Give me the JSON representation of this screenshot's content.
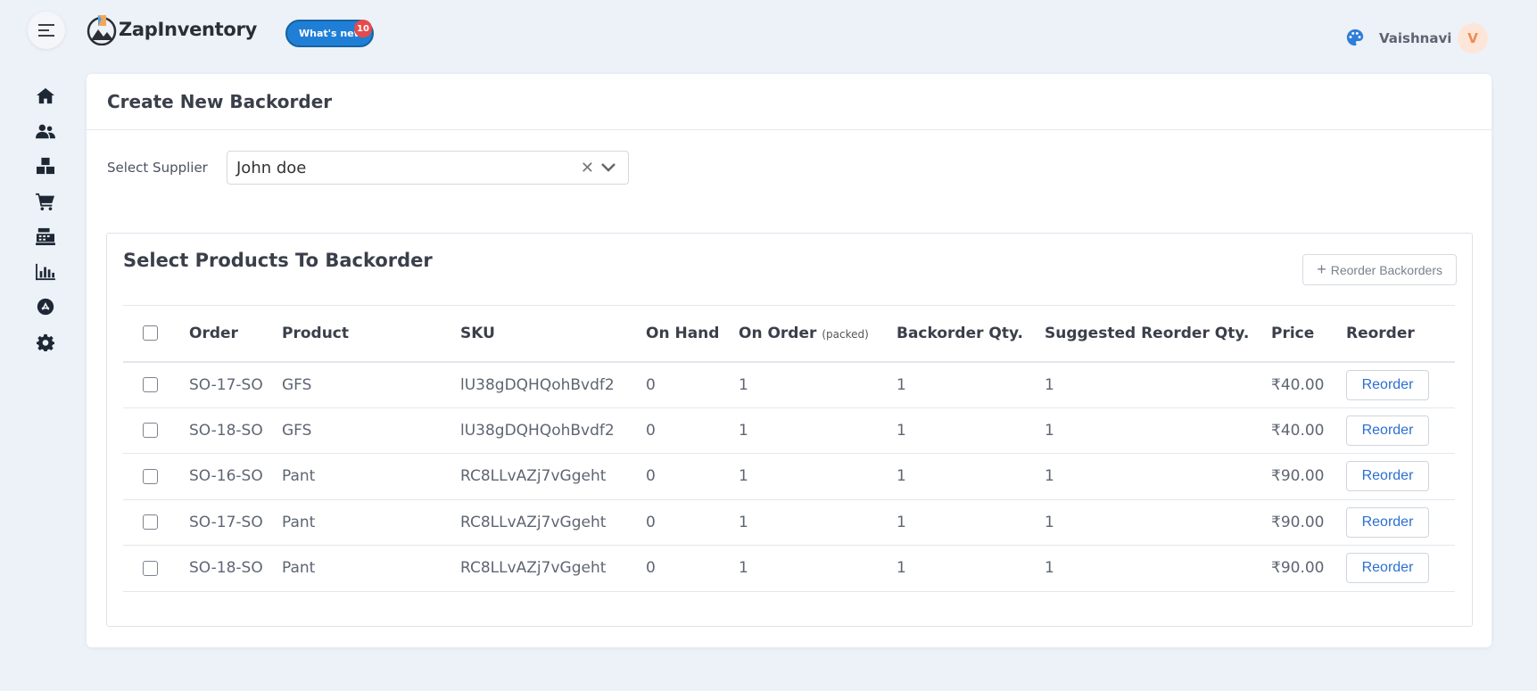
{
  "header": {
    "logo_text": "ZapInventory",
    "whats_new_label": "What's new!",
    "whats_new_count": "10",
    "user_name": "Vaishnavi",
    "user_initial": "V"
  },
  "sidebar": {
    "items": [
      "home-icon",
      "users-icon",
      "boxes-icon",
      "cart-icon",
      "register-icon",
      "chart-icon",
      "app-store-icon",
      "settings-icon"
    ]
  },
  "page": {
    "title": "Create New Backorder",
    "supplier_label": "Select Supplier",
    "supplier_value": "John doe",
    "section_title": "Select Products To Backorder",
    "reorder_all_label": "Reorder Backorders"
  },
  "table": {
    "columns": {
      "order": "Order",
      "product": "Product",
      "sku": "SKU",
      "on_hand": "On Hand",
      "on_order": "On Order",
      "on_order_note": "(packed)",
      "backorder_qty": "Backorder Qty.",
      "suggested_qty": "Suggested Reorder Qty.",
      "price": "Price",
      "reorder": "Reorder"
    },
    "rows": [
      {
        "order": "SO-17-SO",
        "product": "GFS",
        "sku": "lU38gDQHQohBvdf2",
        "on_hand": "0",
        "on_order": "1",
        "backorder_qty": "1",
        "suggested_qty": "1",
        "price": "₹40.00",
        "action": "Reorder"
      },
      {
        "order": "SO-18-SO",
        "product": "GFS",
        "sku": "lU38gDQHQohBvdf2",
        "on_hand": "0",
        "on_order": "1",
        "backorder_qty": "1",
        "suggested_qty": "1",
        "price": "₹40.00",
        "action": "Reorder"
      },
      {
        "order": "SO-16-SO",
        "product": "Pant",
        "sku": "RC8LLvAZj7vGgeht",
        "on_hand": "0",
        "on_order": "1",
        "backorder_qty": "1",
        "suggested_qty": "1",
        "price": "₹90.00",
        "action": "Reorder"
      },
      {
        "order": "SO-17-SO",
        "product": "Pant",
        "sku": "RC8LLvAZj7vGgeht",
        "on_hand": "0",
        "on_order": "1",
        "backorder_qty": "1",
        "suggested_qty": "1",
        "price": "₹90.00",
        "action": "Reorder"
      },
      {
        "order": "SO-18-SO",
        "product": "Pant",
        "sku": "RC8LLvAZj7vGgeht",
        "on_hand": "0",
        "on_order": "1",
        "backorder_qty": "1",
        "suggested_qty": "1",
        "price": "₹90.00",
        "action": "Reorder"
      }
    ]
  },
  "colors": {
    "accent": "#1f7fd6",
    "badge": "#e64a4a",
    "avatar_bg": "#fde6d8",
    "link": "#2c6fd1"
  }
}
